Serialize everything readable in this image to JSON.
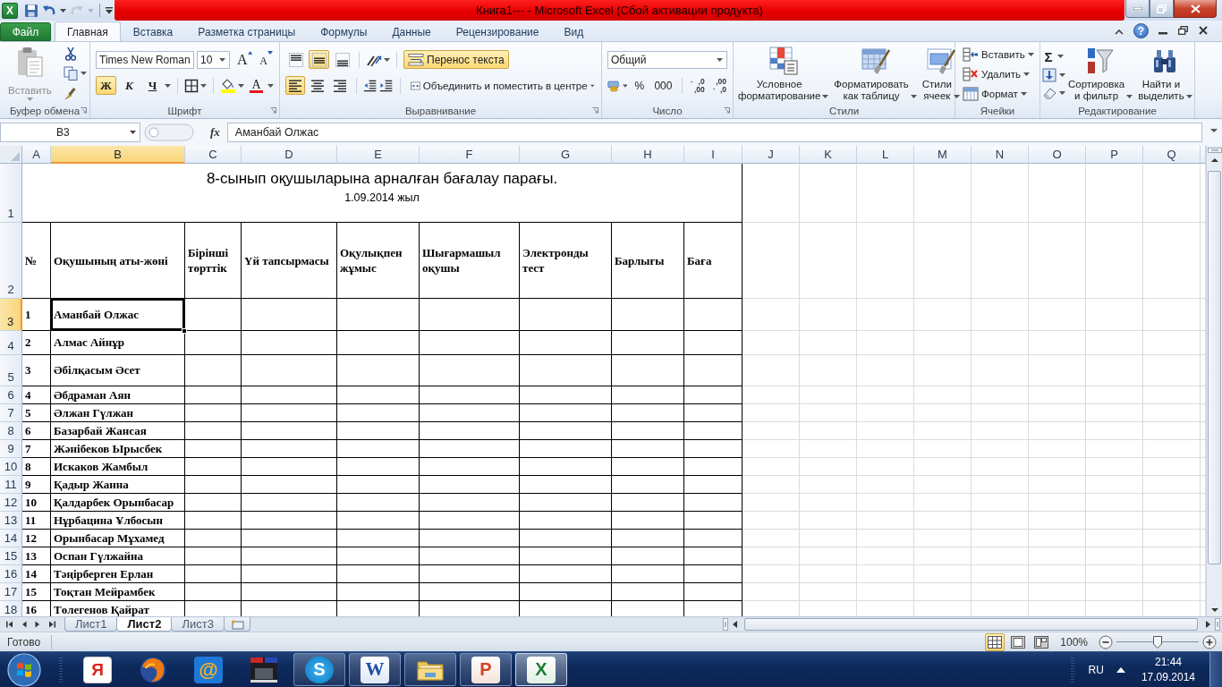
{
  "window": {
    "icon_glyph": "X",
    "title": "Книга1---  -  Microsoft Excel (Сбой активации продукта)"
  },
  "quick_access": [
    {
      "kind": "save",
      "disabled": false
    },
    {
      "kind": "undo",
      "disabled": false
    },
    {
      "kind": "redo",
      "disabled": true
    }
  ],
  "ribbon_tabs": [
    {
      "kind": "file",
      "label": "Файл",
      "selected": false
    },
    {
      "kind": "tab",
      "label": "Главная",
      "selected": true
    },
    {
      "kind": "tab",
      "label": "Вставка",
      "selected": false
    },
    {
      "kind": "tab",
      "label": "Разметка страницы",
      "selected": false
    },
    {
      "kind": "tab",
      "label": "Формулы",
      "selected": false
    },
    {
      "kind": "tab",
      "label": "Данные",
      "selected": false
    },
    {
      "kind": "tab",
      "label": "Рецензирование",
      "selected": false
    },
    {
      "kind": "tab",
      "label": "Вид",
      "selected": false
    }
  ],
  "help": "?",
  "ribbon": {
    "clipboard": {
      "label": "Буфер обмена",
      "paste": {
        "label": "Вставить",
        "disabled": true
      }
    },
    "font": {
      "label": "Шрифт",
      "font_name": "Times New Roman",
      "font_size": "10",
      "grow": "A",
      "shrink": "A",
      "bold": {
        "label": "Ж",
        "on": true
      },
      "italic": {
        "label": "К",
        "on": false
      },
      "underline": {
        "label": "Ч",
        "on": false
      },
      "font_color": "A"
    },
    "alignment": {
      "label": "Выравнивание",
      "vertical": [
        {
          "kind": "top",
          "selected": false
        },
        {
          "kind": "middle",
          "selected": true
        },
        {
          "kind": "bottom",
          "selected": false
        }
      ],
      "horizontal": [
        {
          "kind": "left",
          "selected": true
        },
        {
          "kind": "center",
          "selected": false
        },
        {
          "kind": "right",
          "selected": false
        }
      ],
      "wrap_text": {
        "label": "Перенос текста",
        "on": true
      },
      "merge": "Объединить и поместить в центре"
    },
    "number": {
      "label": "Число",
      "format": "Общий",
      "percent": "%",
      "thousands": "000",
      "decimals": [
        {
          "kind": "increase",
          "top": ",0",
          "bottom": ",00"
        },
        {
          "kind": "decrease",
          "top": ",00",
          "bottom": ",0"
        }
      ]
    },
    "styles": {
      "label": "Стили",
      "buttons": [
        {
          "kind": "conditional",
          "label": "Условное\nформатирование"
        },
        {
          "kind": "table",
          "label": "Форматировать\nкак таблицу"
        },
        {
          "kind": "cell",
          "label": "Стили\nячеек"
        }
      ]
    },
    "cells": {
      "label": "Ячейки",
      "buttons": [
        {
          "kind": "insert",
          "label": "Вставить"
        },
        {
          "kind": "delete",
          "label": "Удалить"
        },
        {
          "kind": "format",
          "label": "Формат"
        }
      ]
    },
    "editing": {
      "label": "Редактирование",
      "sum": "Σ",
      "buttons": [
        {
          "kind": "sort",
          "label": "Сортировка\nи фильтр"
        },
        {
          "kind": "find",
          "label": "Найти и\nвыделить"
        }
      ]
    }
  },
  "formula_bar": {
    "name_box": "B3",
    "function_label": "fx",
    "value": "Аманбай Олжас"
  },
  "columns": [
    {
      "label": "A",
      "selected": false
    },
    {
      "label": "B",
      "selected": true
    },
    {
      "label": "C",
      "selected": false
    },
    {
      "label": "D",
      "selected": false
    },
    {
      "label": "E",
      "selected": false
    },
    {
      "label": "F",
      "selected": false
    },
    {
      "label": "G",
      "selected": false
    },
    {
      "label": "H",
      "selected": false
    },
    {
      "label": "I",
      "selected": false
    },
    {
      "label": "J",
      "selected": false
    },
    {
      "label": "K",
      "selected": false
    },
    {
      "label": "L",
      "selected": false
    },
    {
      "label": "M",
      "selected": false
    },
    {
      "label": "N",
      "selected": false
    },
    {
      "label": "O",
      "selected": false
    },
    {
      "label": "P",
      "selected": false
    },
    {
      "label": "Q",
      "selected": false
    }
  ],
  "sheet": {
    "title_row": {
      "label": "1",
      "selected": false,
      "title": "8-сынып оқушыларына арналған бағалау парағы.",
      "date": "1.09.2014 жыл"
    },
    "header_row": {
      "label": "2",
      "selected": false,
      "cells": [
        "№",
        "Оқушының аты-жөні",
        "Бірінші\nтөрттік",
        "Үй тапсырмасы",
        "Оқулықпен\nжұмыс",
        "Шығармашыл\nоқушы",
        "Электронды\nтест",
        "Барлығы",
        "Баға"
      ]
    },
    "rows": [
      {
        "label": "3",
        "selected": true,
        "active_cell": true,
        "number": "1",
        "name": "Аманбай Олжас"
      },
      {
        "label": "4",
        "selected": false,
        "active_cell": false,
        "number": "2",
        "name": "Алмас Айнұр"
      },
      {
        "label": "5",
        "selected": false,
        "active_cell": false,
        "number": "3",
        "name": "Әбілқасым Әсет"
      },
      {
        "label": "6",
        "selected": false,
        "active_cell": false,
        "number": "4",
        "name": "Әбдраман Аян"
      },
      {
        "label": "7",
        "selected": false,
        "active_cell": false,
        "number": "5",
        "name": "Әлжан Гүлжан"
      },
      {
        "label": "8",
        "selected": false,
        "active_cell": false,
        "number": "6",
        "name": "Базарбай Жансая"
      },
      {
        "label": "9",
        "selected": false,
        "active_cell": false,
        "number": "7",
        "name": "Жәнібеков Ырысбек"
      },
      {
        "label": "10",
        "selected": false,
        "active_cell": false,
        "number": "8",
        "name": "Искаков Жамбыл"
      },
      {
        "label": "11",
        "selected": false,
        "active_cell": false,
        "number": "9",
        "name": "Қадыр Жанна"
      },
      {
        "label": "12",
        "selected": false,
        "active_cell": false,
        "number": "10",
        "name": "Қалдарбек Орынбасар"
      },
      {
        "label": "13",
        "selected": false,
        "active_cell": false,
        "number": "11",
        "name": "Нұрбацина Ұлбосын"
      },
      {
        "label": "14",
        "selected": false,
        "active_cell": false,
        "number": "12",
        "name": "Орынбасар Мұхамед"
      },
      {
        "label": "15",
        "selected": false,
        "active_cell": false,
        "number": "13",
        "name": "Оспан Гүлжайна"
      },
      {
        "label": "16",
        "selected": false,
        "active_cell": false,
        "number": "14",
        "name": "Тәңірберген Ерлан"
      },
      {
        "label": "17",
        "selected": false,
        "active_cell": false,
        "number": "15",
        "name": "Тоқтан Мейрамбек"
      },
      {
        "label": "18",
        "selected": false,
        "active_cell": false,
        "number": "16",
        "name": "Төлегенов Қайрат"
      }
    ]
  },
  "sheet_tabs": [
    {
      "label": "Лист1",
      "selected": false
    },
    {
      "label": "Лист2",
      "selected": true
    },
    {
      "label": "Лист3",
      "selected": false
    }
  ],
  "status_bar": {
    "status": "Готово",
    "views": [
      {
        "kind": "normal",
        "selected": true
      },
      {
        "kind": "layout",
        "selected": false
      },
      {
        "kind": "pagebreak",
        "selected": false
      }
    ],
    "zoom": "100%",
    "zoom_slider": {
      "level": 0.5
    }
  },
  "taskbar": {
    "apps": [
      {
        "kind": "ya",
        "glyph": "Я",
        "running": false,
        "selected": false
      },
      {
        "kind": "fox",
        "running": false,
        "selected": false
      },
      {
        "kind": "mail",
        "glyph": "@",
        "running": false,
        "selected": false
      },
      {
        "kind": "video",
        "running": false,
        "selected": false
      },
      {
        "kind": "chat",
        "glyph": "S",
        "running": true,
        "selected": false
      },
      {
        "kind": "word",
        "glyph": "W",
        "running": true,
        "selected": false
      },
      {
        "kind": "folder",
        "running": true,
        "selected": false
      },
      {
        "kind": "slides",
        "glyph": "P",
        "running": true,
        "selected": false
      },
      {
        "kind": "sheet",
        "glyph": "X",
        "running": true,
        "selected": true
      }
    ],
    "language": "RU",
    "time": "21:44",
    "date": "17.09.2014"
  }
}
